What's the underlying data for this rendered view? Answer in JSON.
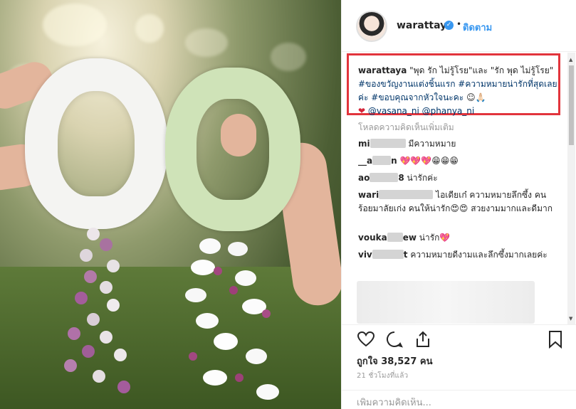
{
  "header": {
    "username": "warattaya",
    "separator": "•",
    "follow_label": "ติดตาม",
    "verified_glyph": "✓"
  },
  "caption": {
    "username": "warattaya",
    "text_1": "\"พุด รัก ไม่รู้โรย\"และ \"รัก พุด ไม่รู้โรย\"",
    "hashtags": "#ของขวัญงานแต่งชิ้นแรก #ความหมายน่ารักที่สุดเลยค่ะ #ขอบคุณจากหัวใจนะคะ",
    "emoji_tail": "☺🙏🏻",
    "heart": "❤",
    "mentions": "@vasana_ni @phanya_ni"
  },
  "load_more_label": "โหลดความคิดเห็นเพิ่มเติม",
  "comments": [
    {
      "user_prefix": "mi",
      "text": "มีความหมาย"
    },
    {
      "user_prefix": "__a",
      "user_suffix": "n",
      "text": "💖💖💖😁😁😁"
    },
    {
      "user_prefix": "ao",
      "user_suffix": "8",
      "text": "น่ารักค่ะ"
    },
    {
      "user_prefix": "wari",
      "text": "ไอเดียเก๋ ความหมายลึกซึ้ง คนร้อยมาลัยเก่ง คนให้น่ารัก😍😍 สวยงามมากและดีมาก"
    },
    {
      "user_prefix": "vouka",
      "user_suffix": "ew",
      "text": "น่ารัก💖"
    },
    {
      "user_prefix": "viv",
      "user_suffix": "t",
      "text": "ความหมายดีงามและลึกซึ้งมากเลยค่ะ"
    }
  ],
  "likes_label": "ถูกใจ 38,527 คน",
  "time_label": "21 ชั่วโมงที่แล้ว",
  "add_comment_placeholder": "เพิ่มความคิดเห็น...",
  "icons": [
    "heart-icon",
    "comment-icon",
    "share-icon",
    "bookmark-icon"
  ],
  "colors": {
    "accent": "#3897f0",
    "highlight_box": "#e2343c",
    "link": "#003569"
  }
}
